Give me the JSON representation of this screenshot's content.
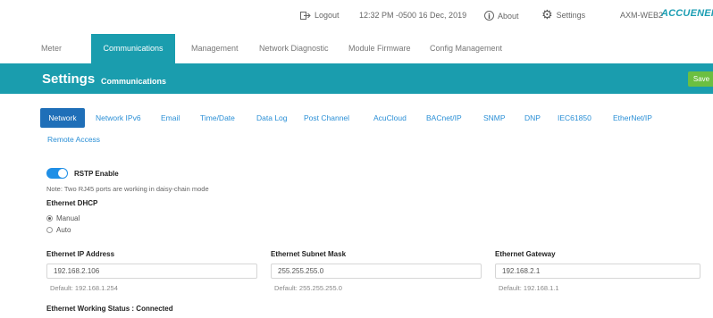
{
  "topbar": {
    "logout_label": "Logout",
    "datetime": "12:32 PM -0500 16 Dec, 2019",
    "about_label": "About",
    "settings_label": "Settings",
    "device_name": "AXM-WEB2",
    "brand": "ACCUENERGY",
    "icons": {
      "logout": "logout-icon",
      "about": "info-icon",
      "settings": "gear-icon"
    }
  },
  "nav": {
    "tabs": [
      {
        "label": "Meter"
      },
      {
        "label": "Communications",
        "active": true
      },
      {
        "label": "Management"
      },
      {
        "label": "Network Diagnostic"
      },
      {
        "label": "Module Firmware"
      },
      {
        "label": "Config Management"
      }
    ]
  },
  "header": {
    "title": "Settings",
    "subtitle": "Communications",
    "save_label": "Save"
  },
  "subtabs": [
    {
      "label": "Network",
      "active": true
    },
    {
      "label": "Network IPv6"
    },
    {
      "label": "Email"
    },
    {
      "label": "Time/Date"
    },
    {
      "label": "Data Log"
    },
    {
      "label": "Post Channel"
    },
    {
      "label": "AcuCloud"
    },
    {
      "label": "BACnet/IP"
    },
    {
      "label": "SNMP"
    },
    {
      "label": "DNP"
    },
    {
      "label": "IEC61850"
    },
    {
      "label": "EtherNet/IP"
    },
    {
      "label": "Remote Access"
    }
  ],
  "form": {
    "rstp_label": "RSTP Enable",
    "rstp_enabled": true,
    "note": "Note: Two RJ45 ports are working in daisy-chain mode",
    "dhcp_label": "Ethernet DHCP",
    "dhcp_options": [
      {
        "label": "Manual",
        "checked": true
      },
      {
        "label": "Auto",
        "checked": false
      }
    ],
    "ip": {
      "label": "Ethernet IP Address",
      "value": "192.168.2.106",
      "default": "Default: 192.168.1.254"
    },
    "subnet": {
      "label": "Ethernet Subnet Mask",
      "value": "255.255.255.0",
      "default": "Default: 255.255.255.0"
    },
    "gateway": {
      "label": "Ethernet Gateway",
      "value": "192.168.2.1",
      "default": "Default: 192.168.1.1"
    },
    "status": "Ethernet Working Status : Connected"
  },
  "colors": {
    "accent": "#1a9dae",
    "active_subtab": "#1f6fb8",
    "link": "#2a8fd6",
    "save": "#6cbf41",
    "toggle": "#1f8fe6"
  }
}
